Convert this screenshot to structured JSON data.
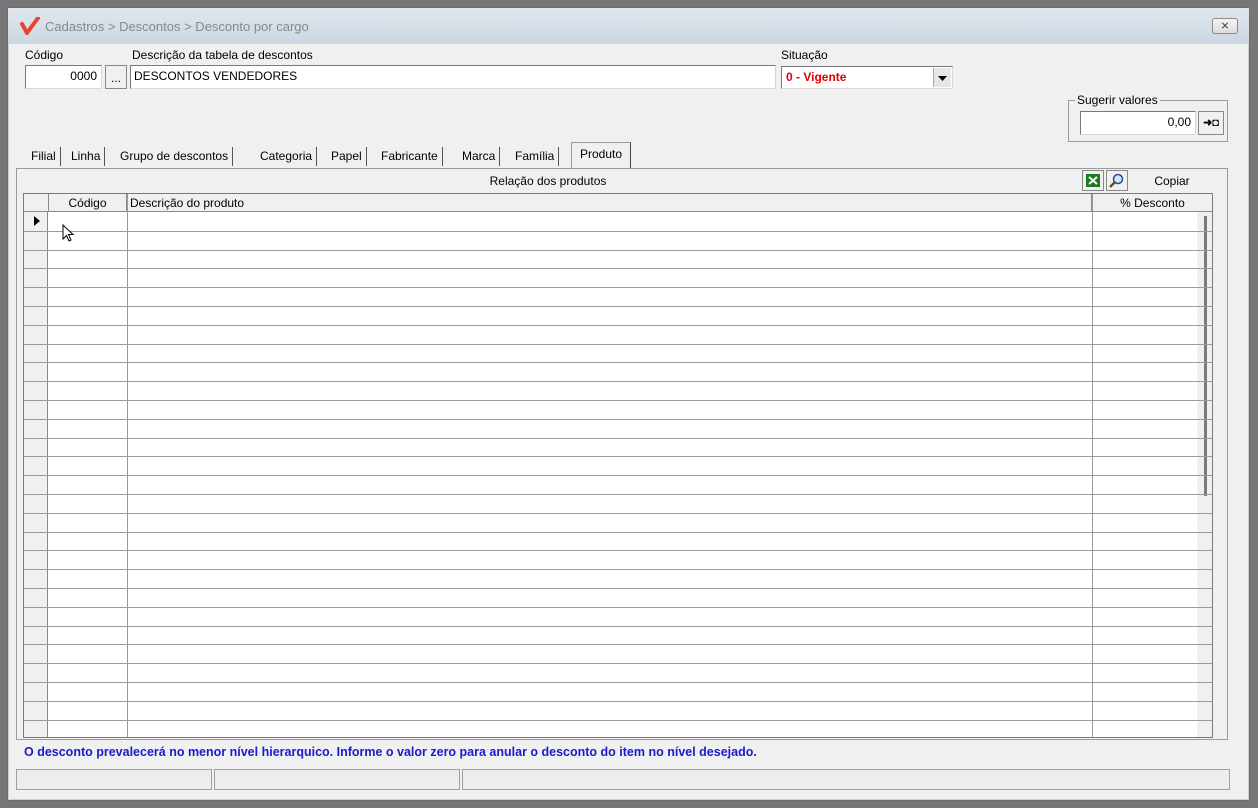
{
  "window": {
    "title": "Cadastros > Descontos > Desconto por cargo",
    "close_symbol": "⨯"
  },
  "form": {
    "codigo_label": "Código",
    "codigo_value": "0000",
    "lookup_button": "...",
    "descricao_label": "Descrição da tabela de descontos",
    "descricao_value": "DESCONTOS VENDEDORES",
    "situacao_label": "Situação",
    "situacao_value": "0 - Vigente",
    "situacao_color": "#e00000",
    "sugerir_label": "Sugerir valores",
    "sugerir_value": "0,00",
    "sugerir_button": "➜◘"
  },
  "tabs": [
    {
      "label": "Filial"
    },
    {
      "label": "Linha"
    },
    {
      "label": "Grupo de descontos"
    },
    {
      "label": "Categoria"
    },
    {
      "label": "Papel"
    },
    {
      "label": "Fabricante"
    },
    {
      "label": "Marca"
    },
    {
      "label": "Família"
    },
    {
      "label": "Produto",
      "active": true
    }
  ],
  "grid": {
    "title": "Relação dos produtos",
    "copy_button": "Copiar",
    "excel_icon": "excel-icon",
    "search_icon": "search-icon",
    "columns": [
      "Código",
      "Descrição do produto",
      "% Desconto"
    ]
  },
  "footer": {
    "message": "O desconto prevalecerá no menor nível hierarquico. Informe o valor zero para anular o desconto do item no nível desejado."
  }
}
